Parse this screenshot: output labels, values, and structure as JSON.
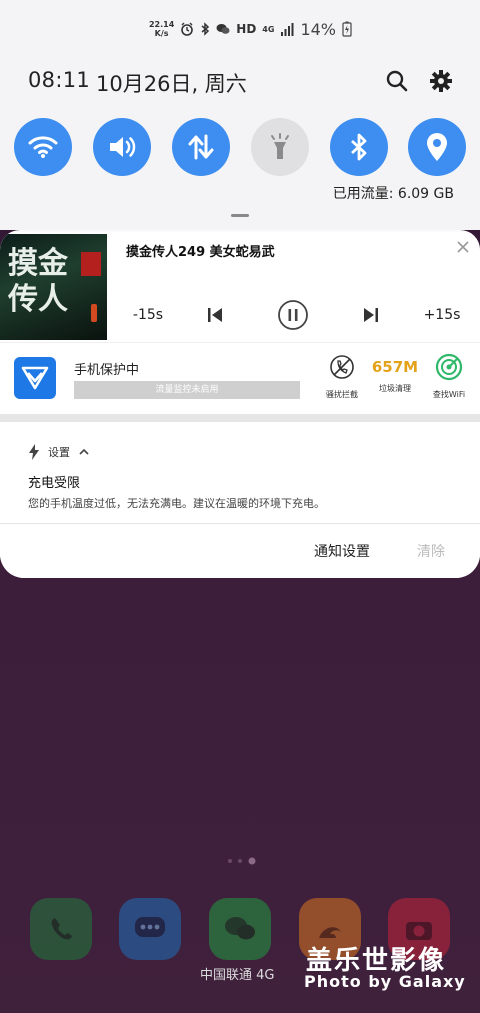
{
  "status_bar": {
    "net_speed_value": "22.14",
    "net_speed_unit": "K/s",
    "hd_label": "HD",
    "network_label": "4G",
    "battery_percent": "14%"
  },
  "quick_settings": {
    "time": "08:11",
    "date": "10月26日, 周六",
    "data_usage": "已用流量: 6.09 GB",
    "tiles": [
      {
        "name": "wifi",
        "state": "on"
      },
      {
        "name": "sound",
        "state": "on"
      },
      {
        "name": "mobile-data",
        "state": "on"
      },
      {
        "name": "flashlight",
        "state": "off"
      },
      {
        "name": "bluetooth",
        "state": "on"
      },
      {
        "name": "location",
        "state": "on"
      }
    ],
    "accent_color": "#3d8ef0"
  },
  "media": {
    "title": "摸金传人249 美女蛇易武",
    "art_text_1": "摸金",
    "art_text_2": "传人",
    "rewind_label": "-15s",
    "forward_label": "+15s"
  },
  "security": {
    "title": "手机保护中",
    "status_bar_text": "流量监控未启用",
    "actions": [
      {
        "label": "骚扰拦截",
        "value": ""
      },
      {
        "label": "垃圾清理",
        "value": "657M"
      },
      {
        "label": "查找WiFi",
        "value": ""
      }
    ],
    "junk_color": "#e3a21a"
  },
  "system_notification": {
    "app_name": "设置",
    "title": "充电受限",
    "body": "您的手机温度过低，无法充满电。建议在温暖的环境下充电。",
    "settings_button": "通知设置",
    "clear_button": "清除"
  },
  "home": {
    "carrier": "中国联通 4G",
    "watermark_cn": "盖乐世影像",
    "watermark_en": "Photo by Galaxy"
  }
}
